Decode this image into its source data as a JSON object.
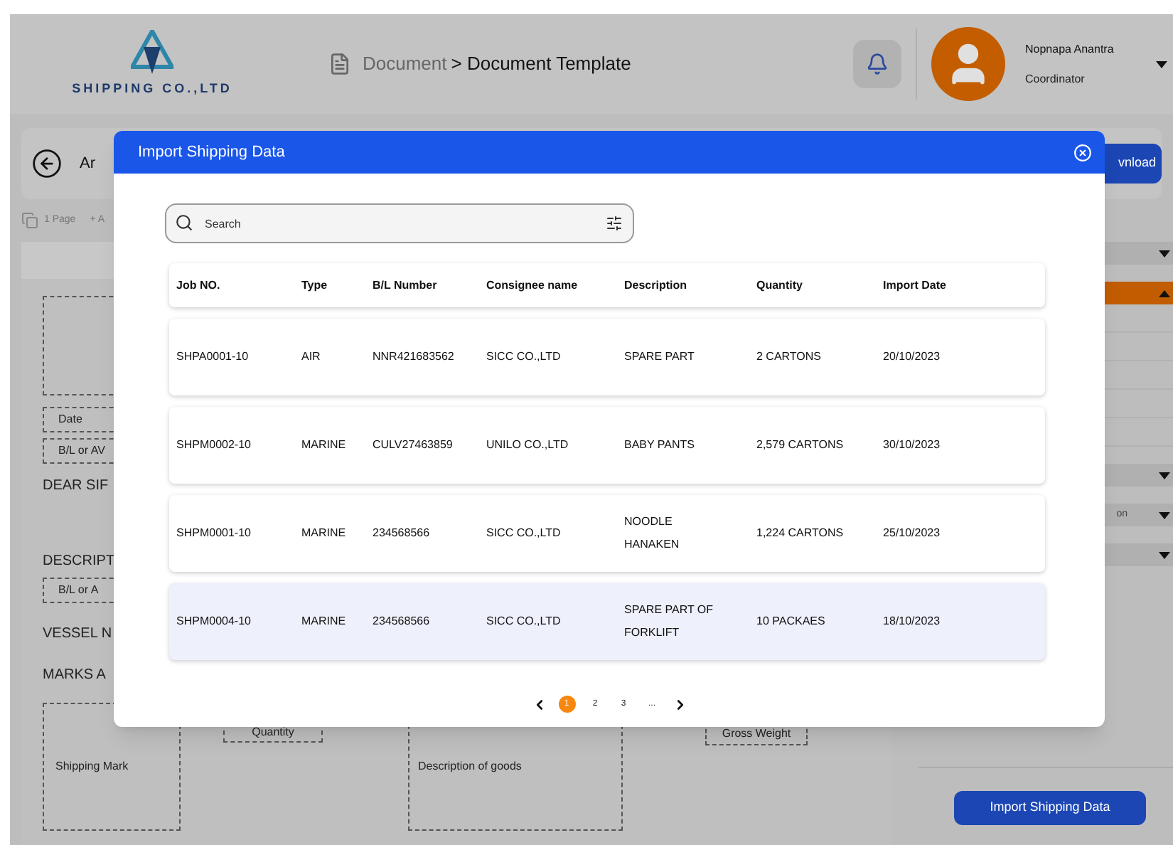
{
  "header": {
    "logo_text": "SHIPPING CO.,LTD",
    "breadcrumb": {
      "parent": "Document",
      "separator": ">",
      "current": "Document Template"
    },
    "user": {
      "name": "Nopnapa Anantra",
      "role": "Coordinator"
    }
  },
  "toolbar": {
    "title": "Ar",
    "download_button": "vnload"
  },
  "page_info": {
    "pages": "1 Page",
    "add": "+ A"
  },
  "document": {
    "fields_left": [
      {
        "kind": "box",
        "text": "Date"
      },
      {
        "kind": "box",
        "text": "B/L or AV"
      },
      {
        "kind": "heading",
        "text": "DEAR SIF"
      },
      {
        "kind": "heading",
        "text": "DESCRIPT"
      },
      {
        "kind": "box",
        "text": "B/L or A"
      },
      {
        "kind": "heading",
        "text": "VESSEL N"
      },
      {
        "kind": "heading",
        "text": "MARKS A"
      }
    ],
    "shipping_mark": "Shipping Mark",
    "quantity": "Quantity",
    "description_of_goods": "Description of goods",
    "gross_weight": "Gross Weight"
  },
  "right_panel": {
    "sections": [
      {
        "kind": "dropdown",
        "expanded": false
      },
      {
        "kind": "dropdown",
        "expanded": true
      },
      {
        "kind": "dropdown",
        "expanded": false
      },
      {
        "kind": "dropdown",
        "text": "on",
        "expanded": false
      },
      {
        "kind": "dropdown",
        "expanded": false
      }
    ],
    "import_button": "Import Shipping Data"
  },
  "modal": {
    "title": "Import Shipping Data",
    "search": {
      "placeholder": "Search"
    },
    "table": {
      "columns": [
        "Job NO.",
        "Type",
        "B/L Number",
        "Consignee name",
        "Description",
        "Quantity",
        "Import Date"
      ],
      "rows": [
        {
          "cells": [
            "SHPA0001-10",
            "AIR",
            "NNR421683562",
            "SICC CO.,LTD",
            "SPARE PART",
            "2 CARTONS",
            "20/10/2023"
          ],
          "selected": false
        },
        {
          "cells": [
            "SHPM0002-10",
            "MARINE",
            "CULV27463859",
            "UNILO CO.,LTD",
            "BABY PANTS",
            "2,579 CARTONS",
            "30/10/2023"
          ],
          "selected": false
        },
        {
          "cells": [
            "SHPM0001-10",
            "MARINE",
            "234568566",
            "SICC CO.,LTD",
            "NOODLE HANAKEN",
            "1,224 CARTONS",
            "25/10/2023"
          ],
          "selected": false
        },
        {
          "cells": [
            "SHPM0004-10",
            "MARINE",
            "234568566",
            "SICC CO.,LTD",
            "SPARE PART OF FORKLIFT",
            "10 PACKAES",
            "18/10/2023"
          ],
          "selected": true
        }
      ]
    },
    "pagination": {
      "pages": [
        {
          "label": "1",
          "selected": true
        },
        {
          "label": "2",
          "selected": false
        },
        {
          "label": "3",
          "selected": false
        },
        {
          "label": "...",
          "selected": false
        }
      ]
    }
  }
}
